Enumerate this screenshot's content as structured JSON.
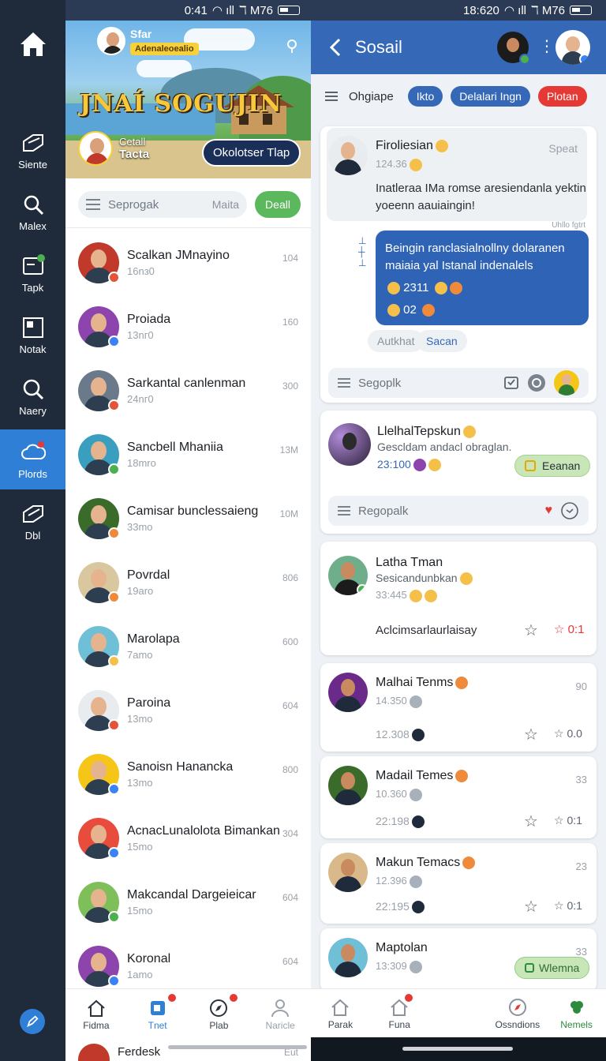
{
  "rail": {
    "items": [
      {
        "label": "Siente",
        "icon": "send-icon"
      },
      {
        "label": "Malex",
        "icon": "search-icon"
      },
      {
        "label": "Tapk",
        "icon": "chat-icon"
      },
      {
        "label": "Notak",
        "icon": "grid-icon"
      },
      {
        "label": "Naery",
        "icon": "search-icon"
      },
      {
        "label": "Plords",
        "icon": "cloud-icon",
        "active": true
      },
      {
        "label": "Dbl",
        "icon": "send-icon"
      }
    ]
  },
  "left": {
    "status_time": "0:41",
    "status_right": "ℸ M76",
    "banner": {
      "user_name": "Sfar",
      "user_sub": "Adenaleoealio",
      "title": "JNAÍ SOGUJIN",
      "card_small": "Cetall",
      "card_big": "Tacta",
      "button": "Okolotser Tlap"
    },
    "search": {
      "placeholder": "Seprogak",
      "hint": "Maita",
      "button": "Deall"
    },
    "chats": [
      {
        "name": "Scalkan JMnayino",
        "sub": "16nз0",
        "time": "104",
        "dot": "#e2553a",
        "bg": "#c0392b"
      },
      {
        "name": "Proiada",
        "sub": "13nг0",
        "time": "160",
        "dot": "#3b82f6",
        "bg": "#8e44ad"
      },
      {
        "name": "Sarkantal canlenman",
        "sub": "24nг0",
        "time": "300",
        "dot": "#e2553a",
        "bg": "#6b7a8a"
      },
      {
        "name": "Sancbell Mhaniia",
        "sub": "18mro",
        "time": "13M",
        "dot": "#4caf50",
        "bg": "#3a9fbf"
      },
      {
        "name": "Camisar bunclessaieng",
        "sub": "33mo",
        "time": "10M",
        "dot": "#ef8a3a",
        "bg": "#3a6b2a"
      },
      {
        "name": "Povrdal",
        "sub": "19aro",
        "time": "806",
        "dot": "#ef8a3a",
        "bg": "#d9c7a0"
      },
      {
        "name": "Marolapa",
        "sub": "7amo",
        "time": "600",
        "dot": "#f5c04a",
        "bg": "#6fbfd6"
      },
      {
        "name": "Paroina",
        "sub": "13mo",
        "time": "604",
        "dot": "#e2553a",
        "bg": "#e8ecef"
      },
      {
        "name": "Sanoisn Hanancka",
        "sub": "13mo",
        "time": "800",
        "dot": "#3b82f6",
        "bg": "#f5c518"
      },
      {
        "name": "AcnacLunalolota Bimankan",
        "sub": "15mo",
        "time": "304",
        "dot": "#3b82f6",
        "bg": "#e74c3c"
      },
      {
        "name": "Makcandal Dargeieicar",
        "sub": "15mo",
        "time": "604",
        "dot": "#4caf50",
        "bg": "#7fbf5a"
      },
      {
        "name": "Koronal",
        "sub": "1amo",
        "time": "604",
        "dot": "#3b82f6",
        "bg": "#8e44ad"
      }
    ],
    "nav": [
      {
        "label": "Fidma",
        "icon": "home-icon"
      },
      {
        "label": "Tnet",
        "icon": "document-icon",
        "active": true,
        "badge": true
      },
      {
        "label": "Plab",
        "icon": "compass-icon",
        "badge": true
      },
      {
        "label": "Naricle",
        "icon": "person-icon"
      }
    ],
    "peek_name": "Ferdesk",
    "peek_time": "Eut"
  },
  "right": {
    "status_time": "18:620",
    "status_right": "ℸ M76",
    "title": "Sosail",
    "filter_label": "Ohgiape",
    "chips": [
      {
        "label": "Ikto",
        "color": "#3668b8"
      },
      {
        "label": "Delalari Ingn",
        "color": "#3668b8"
      },
      {
        "label": "Plotan",
        "color": "#e53935"
      }
    ],
    "thread": {
      "name": "Firoliesian",
      "time": "124.36",
      "action": "Speat",
      "message_in": "Inatleraa IMa romse aresiendanla yektin yoeenn aauiaingin!",
      "meta": "Uhllo fgtrt",
      "message_out": "Beingin ranclasialnollny dolaranen maiaia yal Istanal indenalels",
      "out_count_1": "2311",
      "out_count_2": "02",
      "btn_left": "Autkhat",
      "btn_right": "Sacan",
      "composer": "Segoplk"
    },
    "post1": {
      "name": "LlelhalTepskun",
      "line": "Gescldam andacl obraglan.",
      "time": "23:100",
      "button": "Eeanan",
      "composer": "Regopalk"
    },
    "post2": {
      "name": "Latha Tman",
      "line": "Sesicandunbkan",
      "time": "33:445",
      "footer": "Aclcimsarlaurlaisay",
      "score": "0:1"
    },
    "feed": [
      {
        "name": "Malhai Tenms",
        "time": "14.350",
        "time2": "12.308",
        "side": "90",
        "score": "0.0"
      },
      {
        "name": "Madail Temes",
        "time": "10.360",
        "time2": "22:198",
        "side": "33",
        "score": "0:1"
      },
      {
        "name": "Makun Temacs",
        "time": "12.396",
        "time2": "22:195",
        "side": "23",
        "score": "0:1"
      },
      {
        "name": "Maptolan",
        "time": "13:309",
        "side": "33",
        "button": "Wlemna"
      }
    ],
    "nav": [
      {
        "label": "Parak",
        "icon": "home-icon"
      },
      {
        "label": "Funa",
        "icon": "home-icon",
        "badge": true
      },
      {
        "label": "",
        "icon": "empty"
      },
      {
        "label": "Ossndions",
        "icon": "compass-icon"
      },
      {
        "label": "Nemels",
        "icon": "clover-icon",
        "green": true
      }
    ]
  }
}
